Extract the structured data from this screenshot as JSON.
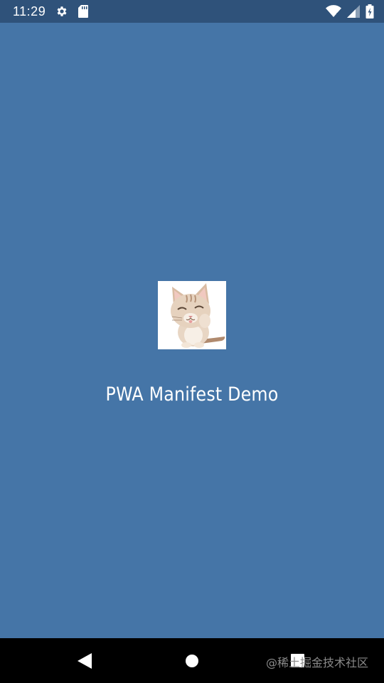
{
  "status_bar": {
    "time": "11:29",
    "left_icons": [
      "gear-icon",
      "sd-card-icon"
    ],
    "right_icons": [
      "wifi-icon",
      "cell-signal-icon",
      "battery-icon"
    ]
  },
  "splash": {
    "background_color": "#4575a7",
    "icon": "kitten-image",
    "app_name": "PWA Manifest Demo"
  },
  "nav_bar": {
    "buttons": [
      "back-icon",
      "home-icon",
      "recents-icon"
    ],
    "watermark": "@稀土掘金技术社区"
  }
}
